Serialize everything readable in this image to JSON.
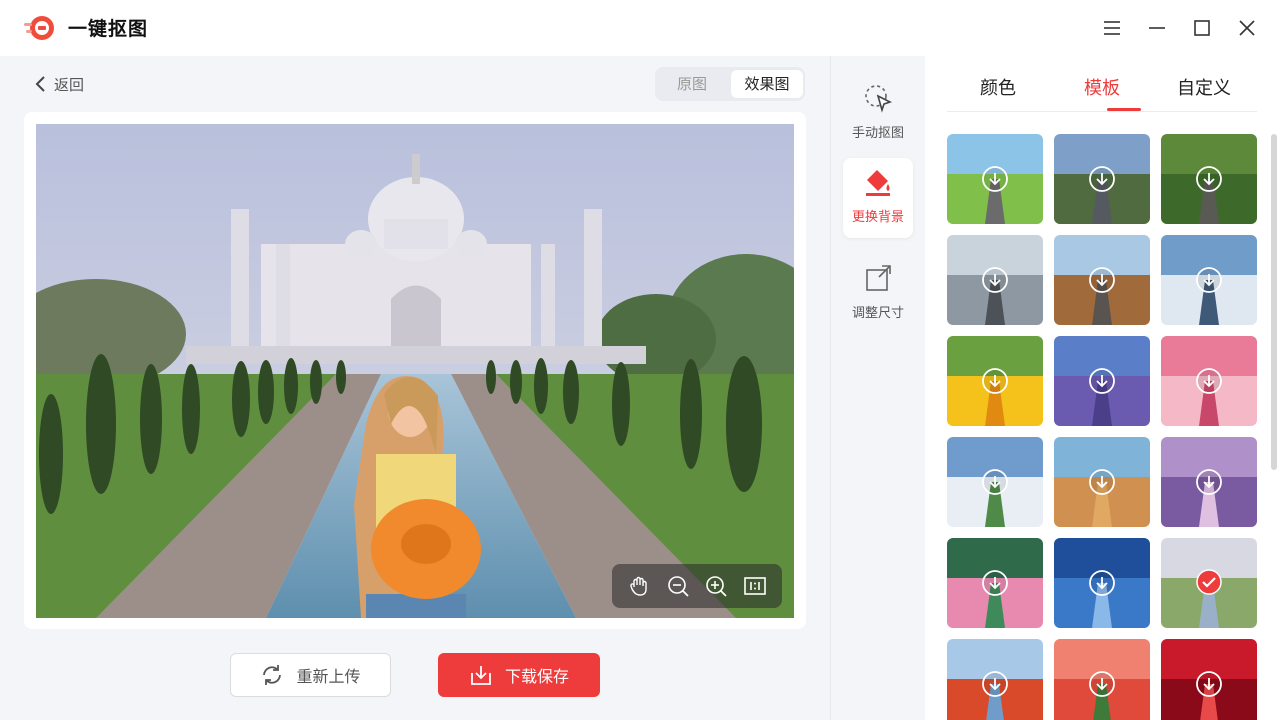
{
  "app": {
    "title": "一键抠图"
  },
  "window_controls": [
    "menu-icon",
    "minimize-icon",
    "maximize-icon",
    "close-icon"
  ],
  "nav": {
    "back_label": "返回"
  },
  "view_toggle": {
    "original_label": "原图",
    "effect_label": "效果图",
    "selected": "效果图"
  },
  "tools": [
    {
      "label": "手动抠图",
      "icon": "cursor-select-icon",
      "active": false
    },
    {
      "label": "更换背景",
      "icon": "paint-bucket-icon",
      "active": true
    },
    {
      "label": "调整尺寸",
      "icon": "resize-icon",
      "active": false
    }
  ],
  "panel": {
    "tabs": [
      {
        "label": "颜色",
        "active": false
      },
      {
        "label": "模板",
        "active": true
      },
      {
        "label": "自定义",
        "active": false
      }
    ]
  },
  "templates": [
    "road-green-hills",
    "road-mountains",
    "road-forest",
    "road-snow-forest",
    "road-canyon",
    "road-snow-lake",
    "sunflowers",
    "lavender-field",
    "pink-flowers",
    "snowy-mountain-lake",
    "desert-rock",
    "eiffel-tower",
    "lotus-flowers",
    "swan-lake",
    "taj-mahal",
    "torii-gate",
    "red-tulips",
    "red-rose"
  ],
  "selected_template": "taj-mahal",
  "zoom_tools": [
    "hand-icon",
    "zoom-out-icon",
    "zoom-in-icon",
    "actual-size-icon"
  ],
  "actions": {
    "reupload_label": "重新上传",
    "save_label": "下载保存"
  },
  "colors": {
    "accent": "#ee3b3b",
    "text": "#333333",
    "background": "#f4f5f8"
  }
}
